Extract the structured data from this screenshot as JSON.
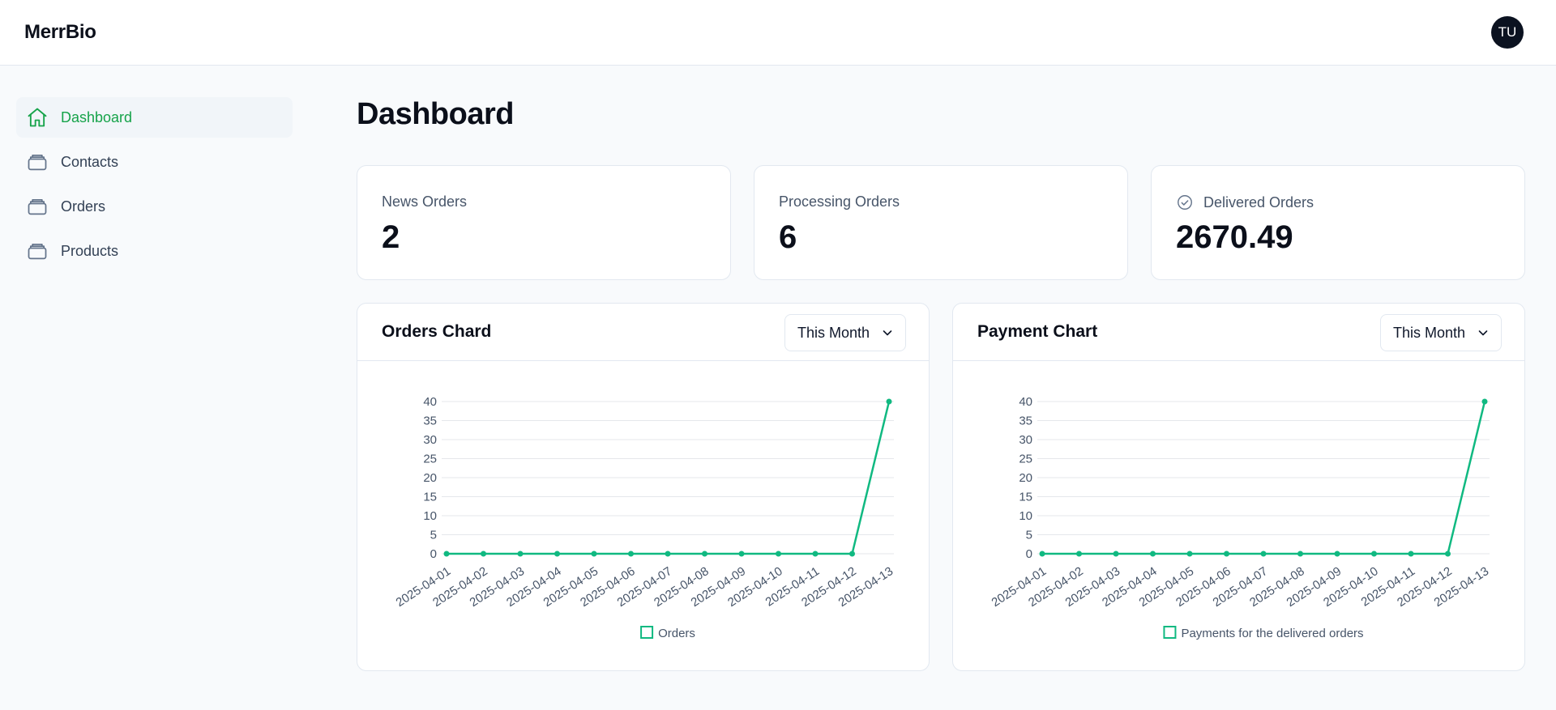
{
  "app": {
    "brand": "MerrBio",
    "avatar_initials": "TU",
    "accent": "#10b981",
    "active_nav_color": "#16a34a"
  },
  "sidebar": {
    "items": [
      {
        "label": "Dashboard",
        "icon": "home-icon",
        "active": true
      },
      {
        "label": "Contacts",
        "icon": "inbox-icon",
        "active": false
      },
      {
        "label": "Orders",
        "icon": "inbox-icon",
        "active": false
      },
      {
        "label": "Products",
        "icon": "inbox-icon",
        "active": false
      }
    ]
  },
  "page": {
    "title": "Dashboard"
  },
  "stats": [
    {
      "label": "News Orders",
      "value": "2"
    },
    {
      "label": "Processing Orders",
      "value": "6"
    },
    {
      "label": "Delivered Orders",
      "value": "2670.49",
      "icon": "check-circle-icon"
    }
  ],
  "charts": [
    {
      "title": "Orders Chard",
      "range_label": "This Month"
    },
    {
      "title": "Payment Chart",
      "range_label": "This Month"
    }
  ],
  "chart_data": [
    {
      "type": "line",
      "x": [
        "2025-04-01",
        "2025-04-02",
        "2025-04-03",
        "2025-04-04",
        "2025-04-05",
        "2025-04-06",
        "2025-04-07",
        "2025-04-08",
        "2025-04-09",
        "2025-04-10",
        "2025-04-11",
        "2025-04-12",
        "2025-04-13"
      ],
      "series": [
        {
          "name": "Orders",
          "values": [
            0,
            0,
            0,
            0,
            0,
            0,
            0,
            0,
            0,
            0,
            0,
            0,
            40
          ],
          "color": "#10b981"
        }
      ],
      "ylim": [
        0,
        40
      ],
      "yticks": [
        0,
        5,
        10,
        15,
        20,
        25,
        30,
        35,
        40
      ],
      "grid": true,
      "legend": "bottom"
    },
    {
      "type": "line",
      "x": [
        "2025-04-01",
        "2025-04-02",
        "2025-04-03",
        "2025-04-04",
        "2025-04-05",
        "2025-04-06",
        "2025-04-07",
        "2025-04-08",
        "2025-04-09",
        "2025-04-10",
        "2025-04-11",
        "2025-04-12",
        "2025-04-13"
      ],
      "series": [
        {
          "name": "Payments for the delivered orders",
          "values": [
            0,
            0,
            0,
            0,
            0,
            0,
            0,
            0,
            0,
            0,
            0,
            0,
            40
          ],
          "color": "#10b981"
        }
      ],
      "ylim": [
        0,
        40
      ],
      "yticks": [
        0,
        5,
        10,
        15,
        20,
        25,
        30,
        35,
        40
      ],
      "grid": true,
      "legend": "bottom"
    }
  ]
}
